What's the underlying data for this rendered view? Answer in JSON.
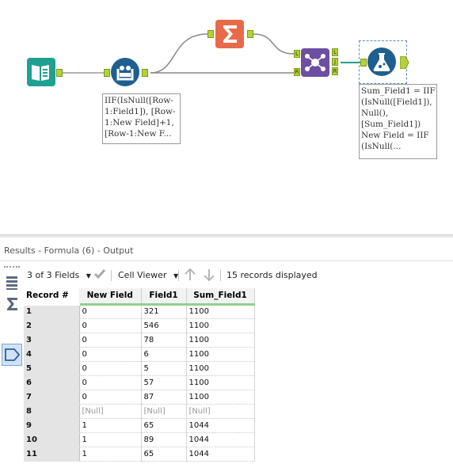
{
  "workflow": {
    "annotations": {
      "formula1": "IIF(IsNull([Row-\n1:Field1]), [Row-\n1:New Field]+1,\n[Row-1:New F...",
      "formula2": "Sum_Field1 = IIF\n(IsNull([Field1]),\nNull(),\n[Sum_Field1])\nNew Field = IIF\n(IsNull(..."
    },
    "anchors": {
      "left": "L",
      "right": "R",
      "join": "J"
    },
    "icons": {
      "input": "book-input-icon",
      "multirow": "multi-row-formula-icon",
      "summarize": "sigma-summarize-icon",
      "join": "join-icon",
      "formula": "formula-flask-icon"
    },
    "colors": {
      "input": "#1fa091",
      "multirow": "#1f5f8f",
      "summarize": "#e96a4b",
      "join": "#6d4ea1",
      "formula": "#1f5f8f",
      "anchor": "#b3d237"
    }
  },
  "results": {
    "title": "Results - Formula (6) - Output",
    "toolbar": {
      "fields": "3 of 3 Fields",
      "viewer": "Cell Viewer",
      "count": "15 records displayed"
    },
    "columns": [
      "Record #",
      "New Field",
      "Field1",
      "Sum_Field1"
    ],
    "rows": [
      [
        "1",
        "0",
        "321",
        "1100"
      ],
      [
        "2",
        "0",
        "546",
        "1100"
      ],
      [
        "3",
        "0",
        "78",
        "1100"
      ],
      [
        "4",
        "0",
        "6",
        "1100"
      ],
      [
        "5",
        "0",
        "5",
        "1100"
      ],
      [
        "6",
        "0",
        "57",
        "1100"
      ],
      [
        "7",
        "0",
        "87",
        "1100"
      ],
      [
        "8",
        "[Null]",
        "[Null]",
        "[Null]"
      ],
      [
        "9",
        "1",
        "65",
        "1044"
      ],
      [
        "10",
        "1",
        "89",
        "1044"
      ],
      [
        "11",
        "1",
        "65",
        "1044"
      ]
    ]
  }
}
